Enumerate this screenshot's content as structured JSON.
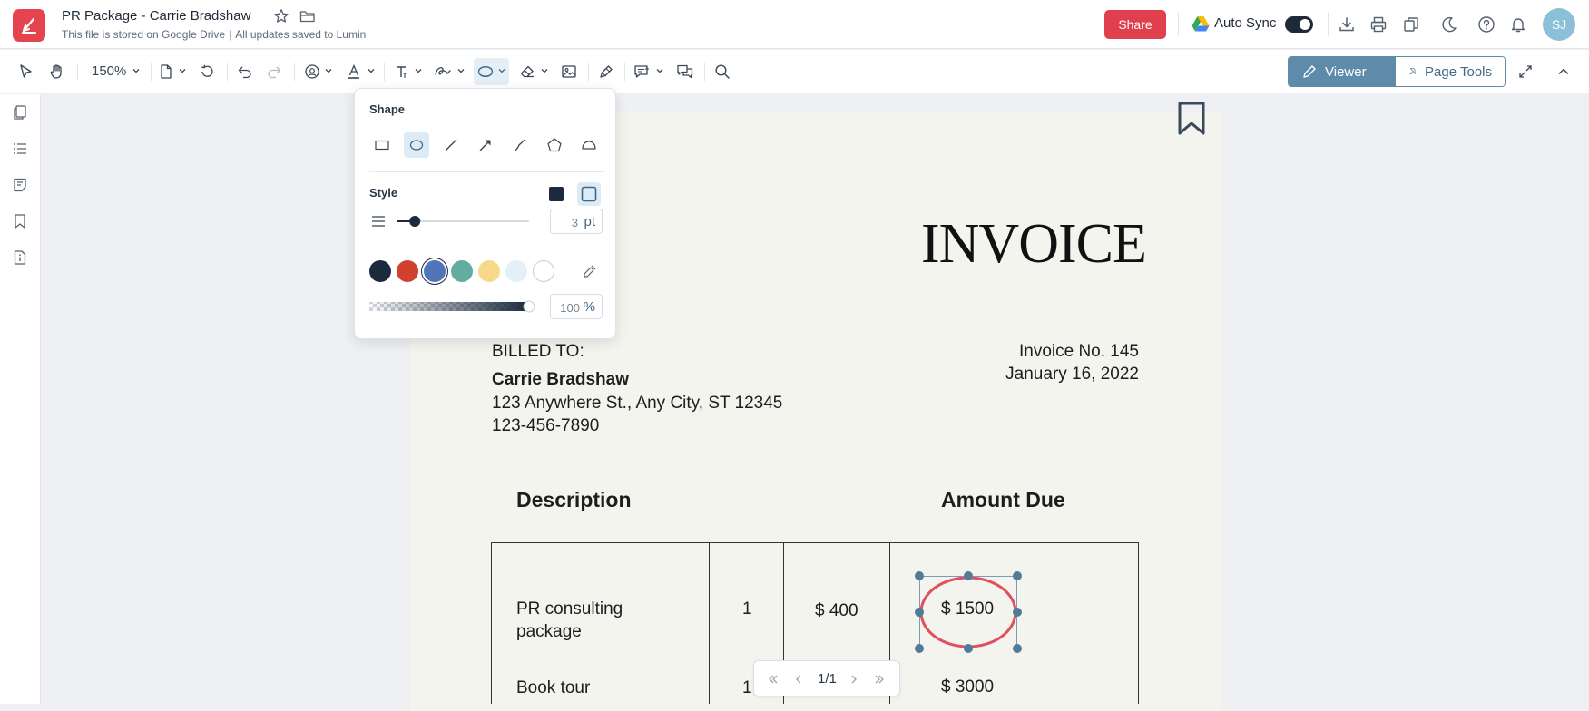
{
  "header": {
    "title": "PR Package - Carrie Bradshaw",
    "storage_note": "This file is stored on Google Drive",
    "save_note": "All updates saved to Lumin",
    "share_label": "Share",
    "autosync_label": "Auto Sync",
    "autosync_on": true,
    "avatar_initials": "SJ",
    "icons": [
      "star-icon",
      "folder-icon",
      "google-drive-icon",
      "download-icon",
      "print-icon",
      "copy-icon",
      "dark-mode-icon",
      "help-icon",
      "bell-icon"
    ]
  },
  "toolbar": {
    "zoom": "150%",
    "active_tool": "shape",
    "modes": {
      "viewer": "Viewer",
      "page_tools": "Page Tools"
    },
    "tools": [
      "pointer-icon",
      "hand-icon",
      "page-icon",
      "rotate-icon",
      "undo-icon",
      "redo-icon",
      "stamp-icon",
      "text-color-icon",
      "text-tool-icon",
      "signature-icon",
      "shape-icon",
      "eraser-icon",
      "image-icon",
      "highlighter-icon",
      "comment-icon",
      "chat-icon",
      "search-icon",
      "expand-icon",
      "collapse-icon"
    ]
  },
  "sidebar": {
    "items": [
      "pages-icon",
      "list-icon",
      "notes-icon",
      "bookmark-icon",
      "info-icon"
    ]
  },
  "shape_panel": {
    "shape_label": "Shape",
    "style_label": "Style",
    "shapes": [
      "rectangle",
      "ellipse",
      "line",
      "arrow",
      "curve",
      "polygon",
      "cloud"
    ],
    "selected_shape": "ellipse",
    "style_selected": "outline",
    "thickness": "3",
    "thickness_unit": "pt",
    "thickness_level": 0.1,
    "opacity": "100",
    "opacity_unit": "%",
    "colors": [
      "#1b2a3d",
      "#d0412f",
      "#5274b8",
      "#62ad9f",
      "#f7d98a",
      "#e3f0f8",
      "#ffffff"
    ],
    "selected_color": "#5274b8"
  },
  "document": {
    "title": "INVOICE",
    "billed_to_label": "BILLED TO:",
    "client_name": "Carrie Bradshaw",
    "address": "123 Anywhere St., Any City, ST 12345",
    "phone": "123-456-7890",
    "invoice_no": "Invoice No. 145",
    "date": "January 16, 2022",
    "col_description": "Description",
    "col_amount_due": "Amount Due",
    "rows": [
      {
        "desc_line1": "PR consulting",
        "desc_line2": "package",
        "qty": "1",
        "price": "$ 400",
        "amount": "$ 1500"
      },
      {
        "desc_line1": "Book tour",
        "qty": "1",
        "amount": "$ 3000"
      }
    ],
    "annotation": {
      "shape": "ellipse",
      "color": "#e0505e"
    }
  },
  "pager": {
    "page": "1/1"
  }
}
